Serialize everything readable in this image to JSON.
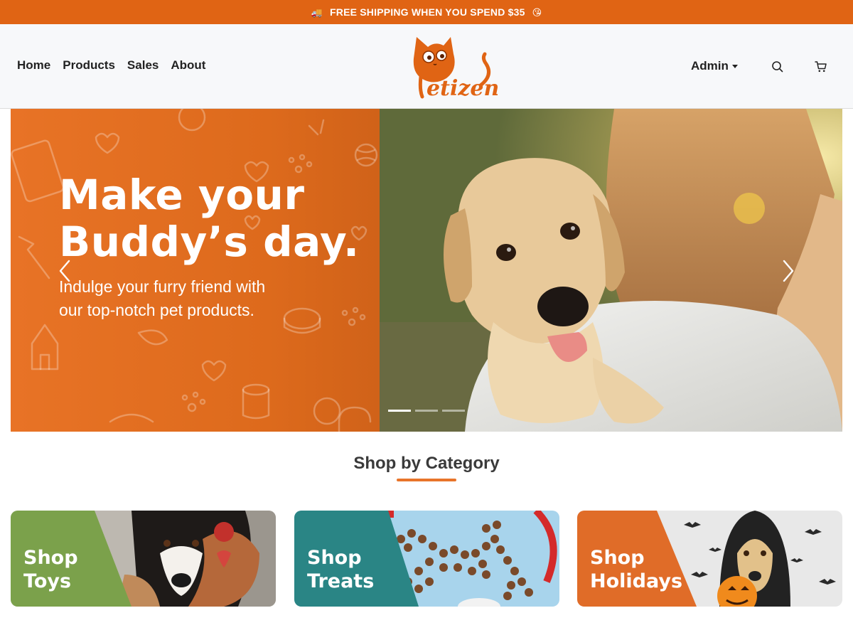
{
  "promo": {
    "text": "FREE SHIPPING WHEN YOU SPEND $35"
  },
  "nav": {
    "links": [
      "Home",
      "Products",
      "Sales",
      "About"
    ],
    "logo_text": "petizen",
    "admin_label": "Admin"
  },
  "hero": {
    "title_line1": "Make your",
    "title_line2": "Buddy’s day.",
    "subtitle_line1": "Indulge your furry friend with",
    "subtitle_line2": "our top-notch pet products."
  },
  "section": {
    "title": "Shop by Category"
  },
  "categories": [
    {
      "line1": "Shop",
      "line2": "Toys",
      "color": "#7ba14b"
    },
    {
      "line1": "Shop",
      "line2": "Treats",
      "color": "#2a8585"
    },
    {
      "line1": "Shop",
      "line2": "Holidays",
      "color": "#e06c28"
    }
  ],
  "colors": {
    "brand_orange": "#e06414",
    "accent": "#e8742a"
  }
}
